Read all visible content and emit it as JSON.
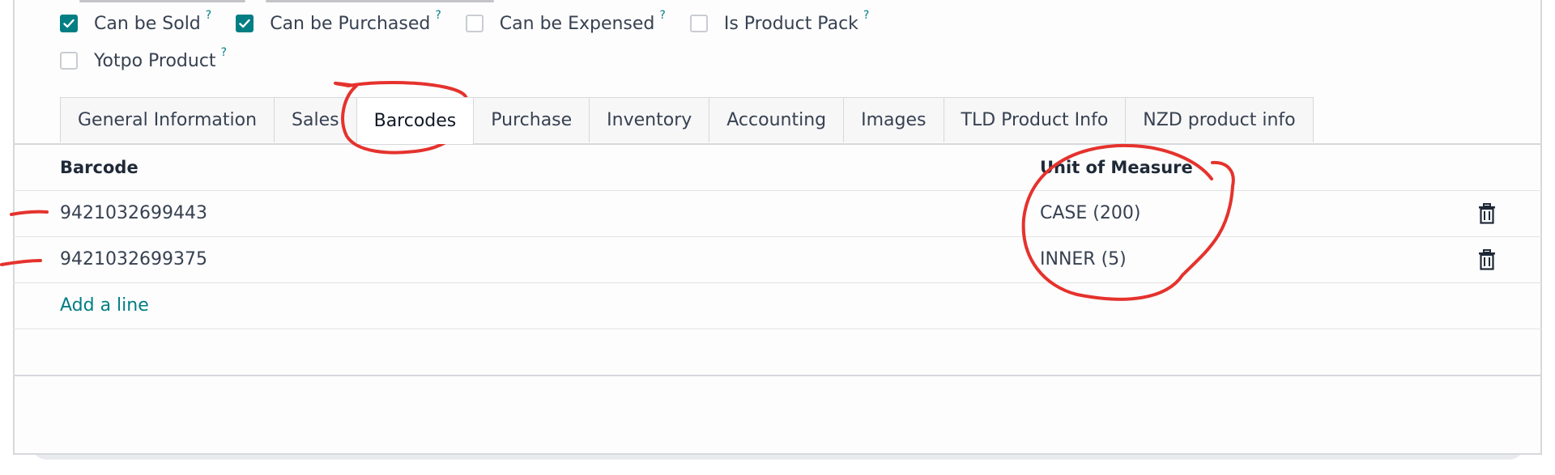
{
  "options": {
    "row1": [
      {
        "label": "Can be Sold",
        "checked": true,
        "help": "?"
      },
      {
        "label": "Can be Purchased",
        "checked": true,
        "help": "?"
      },
      {
        "label": "Can be Expensed",
        "checked": false,
        "help": "?"
      },
      {
        "label": "Is Product Pack",
        "checked": false,
        "help": "?"
      }
    ],
    "row2": [
      {
        "label": "Yotpo Product",
        "checked": false,
        "help": "?"
      }
    ]
  },
  "tabs": [
    {
      "label": "General Information"
    },
    {
      "label": "Sales"
    },
    {
      "label": "Barcodes",
      "active": true
    },
    {
      "label": "Purchase"
    },
    {
      "label": "Inventory"
    },
    {
      "label": "Accounting"
    },
    {
      "label": "Images"
    },
    {
      "label": "TLD Product Info"
    },
    {
      "label": "NZD product info"
    }
  ],
  "table": {
    "headers": {
      "barcode": "Barcode",
      "uom": "Unit of Measure"
    },
    "rows": [
      {
        "barcode": "9421032699443",
        "uom": "CASE (200)"
      },
      {
        "barcode": "9421032699375",
        "uom": "INNER (5)"
      }
    ],
    "add_line": "Add a line"
  },
  "icons": {
    "checkbox": "check-icon",
    "delete": "trash-icon"
  },
  "colors": {
    "accent": "#017e84",
    "annotation": "#e5322d"
  }
}
